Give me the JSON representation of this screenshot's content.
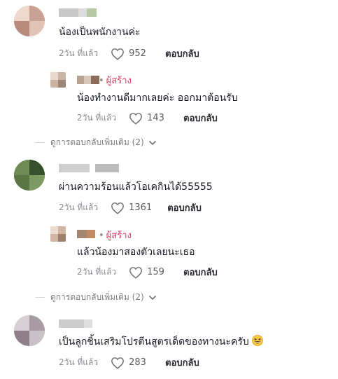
{
  "comments": [
    {
      "text": "น้องเป็นพนักงานค่ะ",
      "time": "2วัน ที่แล้ว",
      "likes": "952",
      "reply_label": "ตอบกลับ",
      "replies": [
        {
          "creator_label": "ผู้สร้าง",
          "text": "น้องทำงานดีมากเลยค่ะ ออกมาต้อนรับ",
          "time": "2วัน ที่แล้ว",
          "likes": "143",
          "reply_label": "ตอบกลับ"
        }
      ],
      "more_replies": "ดูการตอบกลับเพิ่มเติม (2)"
    },
    {
      "text": "ผ่านความร้อนแล้วโอเคกินได้55555",
      "time": "2วัน ที่แล้ว",
      "likes": "1361",
      "reply_label": "ตอบกลับ",
      "replies": [
        {
          "creator_label": "ผู้สร้าง",
          "text": "แล้วน้องมาสองตัวเลยนะเธอ",
          "time": "2วัน ที่แล้ว",
          "likes": "159",
          "reply_label": "ตอบกลับ"
        }
      ],
      "more_replies": "ดูการตอบกลับเพิ่มเติม (2)"
    },
    {
      "text": "เป็นลูกชิ้นเสริมโปรตีนสูตรเด็ดของทางนะครับ",
      "time": "2วัน ที่แล้ว",
      "likes": "283",
      "reply_label": "ตอบกลับ"
    }
  ],
  "colors": {
    "creator": "#e33a61",
    "meta": "#8a8b91",
    "text": "#161823"
  },
  "icons": {
    "like": "heart-outline-icon",
    "expand": "chevron-down-icon",
    "emoji": "grinning-squinting-face-emoji"
  }
}
